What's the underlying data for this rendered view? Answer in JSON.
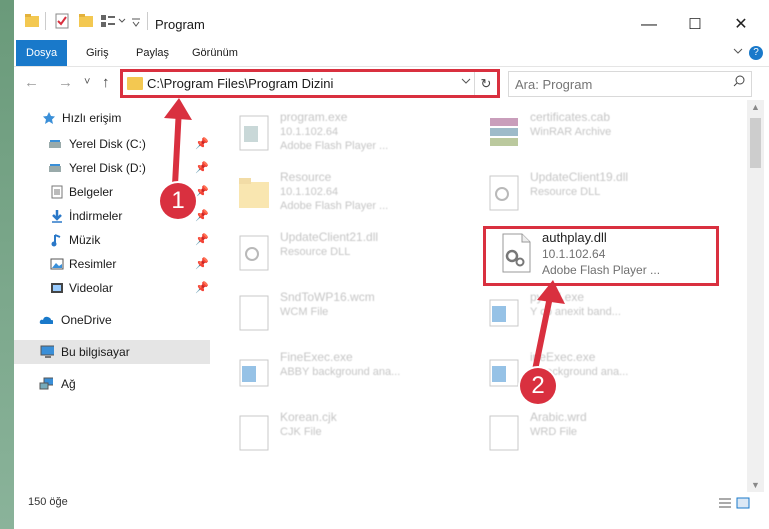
{
  "window": {
    "title": "Program",
    "controls": {
      "minimize": "—",
      "maximize": "☐",
      "close": "✕"
    }
  },
  "ribbon": {
    "tabs": [
      {
        "label": "Dosya",
        "active": true
      },
      {
        "label": "Giriş"
      },
      {
        "label": "Paylaş"
      },
      {
        "label": "Görünüm"
      }
    ],
    "help": "?"
  },
  "nav": {
    "back": "←",
    "forward": "→",
    "recent": "˅",
    "up": "↑",
    "address": "C:\\Program Files\\Program Dizini",
    "refresh": "↻",
    "search_placeholder": "Ara: Program"
  },
  "sidebar": {
    "items": [
      {
        "label": "Hızlı erişim",
        "icon": "star-icon"
      },
      {
        "label": "Yerel Disk (C:)",
        "icon": "drive-icon",
        "pinned": true
      },
      {
        "label": "Yerel Disk (D:)",
        "icon": "drive-icon",
        "pinned": true
      },
      {
        "label": "Belgeler",
        "icon": "documents-icon",
        "pinned": true
      },
      {
        "label": "İndirmeler",
        "icon": "download-icon",
        "pinned": true
      },
      {
        "label": "Müzik",
        "icon": "music-icon",
        "pinned": true
      },
      {
        "label": "Resimler",
        "icon": "pictures-icon",
        "pinned": true
      },
      {
        "label": "Videolar",
        "icon": "videos-icon",
        "pinned": true
      },
      {
        "label": "OneDrive",
        "icon": "cloud-icon"
      },
      {
        "label": "Bu bilgisayar",
        "icon": "computer-icon",
        "selected": true
      },
      {
        "label": "Ağ",
        "icon": "network-icon"
      }
    ]
  },
  "files": [
    {
      "name": "program.exe",
      "ver": "10.1.102.64",
      "desc": "Adobe Flash Player ...",
      "icon": "exe-icon"
    },
    {
      "name": "certificates.cab",
      "ver": "WinRAR Archive",
      "desc": "",
      "icon": "archive-icon"
    },
    {
      "name": "Resource",
      "ver": "10.1.102.64",
      "desc": "Adobe Flash Player ...",
      "icon": "folder-icon"
    },
    {
      "name": "UpdateClient19.dll",
      "ver": "Resource DLL",
      "desc": "",
      "icon": "dll-icon"
    },
    {
      "name": "UpdateClient21.dll",
      "ver": "Resource DLL",
      "desc": "",
      "icon": "dll-icon"
    },
    {
      "name": "authplay.dll",
      "ver": "10.1.102.64",
      "desc": "Adobe Flash Player ...",
      "icon": "dll-icon",
      "highlighted": true
    },
    {
      "name": "SndToWP16.wcm",
      "ver": "WCM File",
      "desc": "",
      "icon": "file-icon"
    },
    {
      "name": "pySTI.exe",
      "ver": "Y cb anexit band...",
      "desc": "",
      "icon": "app-icon"
    },
    {
      "name": "FineExec.exe",
      "ver": "ABBY background ana...",
      "desc": "",
      "icon": "app-icon"
    },
    {
      "name": "ineExec.exe",
      "ver": "Y background ana...",
      "desc": "",
      "icon": "app-icon"
    },
    {
      "name": "Korean.cjk",
      "ver": "CJK File",
      "desc": "",
      "icon": "file-icon"
    },
    {
      "name": "Arabic.wrd",
      "ver": "WRD File",
      "desc": "",
      "icon": "file-icon"
    }
  ],
  "status": {
    "count": "150 öğe"
  },
  "annotations": {
    "step1": "1",
    "step2": "2",
    "color": "#d9303f"
  }
}
